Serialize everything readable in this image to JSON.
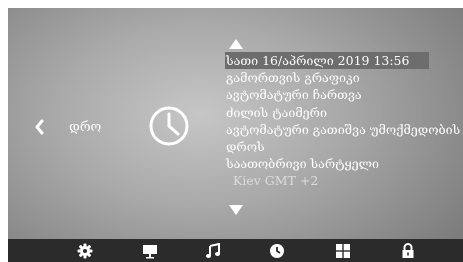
{
  "nav": {
    "category_label": "დრო",
    "back_icon": "chevron-left-icon",
    "category_icon": "clock-icon"
  },
  "menu": {
    "items": [
      {
        "label": "სათი 16/აპრილი 2019 13:56",
        "selected": true
      },
      {
        "label": "გამორთვის გრაფიკი"
      },
      {
        "label": "ავტომატური ჩართვა"
      },
      {
        "label": "ძილის ტაიმერი"
      },
      {
        "label": "ავტომატური გათიშვა უმოქმედობის"
      },
      {
        "label": "დროს"
      },
      {
        "label": "საათობრივი სარტყელი"
      }
    ],
    "sub_value": "Kiev GMT +2",
    "scroll_up_icon": "arrow-up-icon",
    "scroll_down_icon": "arrow-down-icon"
  },
  "bottom_bar": {
    "icons": [
      "gear-icon",
      "monitor-icon",
      "music-note-icon",
      "clock-icon",
      "grid-icon",
      "lock-icon"
    ]
  },
  "colors": {
    "selected_bg": "#6d6d6d",
    "bottom_bar": "#2b2b2b",
    "text": "#ffffff"
  }
}
